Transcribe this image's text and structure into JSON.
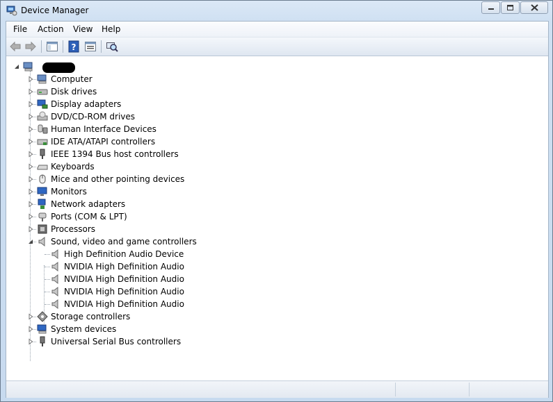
{
  "window": {
    "title": "Device Manager"
  },
  "menu": [
    "File",
    "Action",
    "View",
    "Help"
  ],
  "toolbar": [
    {
      "name": "back-button",
      "icon": "arrow-left-icon"
    },
    {
      "name": "forward-button",
      "icon": "arrow-right-icon"
    },
    {
      "name": "show-hide-console-tree-button",
      "icon": "console-tree-icon"
    },
    {
      "name": "help-button",
      "icon": "help-icon"
    },
    {
      "name": "properties-button",
      "icon": "properties-icon"
    },
    {
      "name": "scan-hardware-button",
      "icon": "scan-hardware-icon"
    }
  ],
  "tree": {
    "root_label": "",
    "categories": [
      {
        "label": "Computer",
        "icon": "computer-icon",
        "expanded": false
      },
      {
        "label": "Disk drives",
        "icon": "disk-drive-icon",
        "expanded": false
      },
      {
        "label": "Display adapters",
        "icon": "display-adapter-icon",
        "expanded": false
      },
      {
        "label": "DVD/CD-ROM drives",
        "icon": "dvd-drive-icon",
        "expanded": false
      },
      {
        "label": "Human Interface Devices",
        "icon": "hid-icon",
        "expanded": false
      },
      {
        "label": "IDE ATA/ATAPI controllers",
        "icon": "ide-controller-icon",
        "expanded": false
      },
      {
        "label": "IEEE 1394 Bus host controllers",
        "icon": "ieee1394-icon",
        "expanded": false
      },
      {
        "label": "Keyboards",
        "icon": "keyboard-icon",
        "expanded": false
      },
      {
        "label": "Mice and other pointing devices",
        "icon": "mouse-icon",
        "expanded": false
      },
      {
        "label": "Monitors",
        "icon": "monitor-icon",
        "expanded": false
      },
      {
        "label": "Network adapters",
        "icon": "network-adapter-icon",
        "expanded": false
      },
      {
        "label": "Ports (COM & LPT)",
        "icon": "port-icon",
        "expanded": false
      },
      {
        "label": "Processors",
        "icon": "processor-icon",
        "expanded": false
      },
      {
        "label": "Sound, video and game controllers",
        "icon": "speaker-icon",
        "expanded": true,
        "children": [
          {
            "label": "High Definition Audio Device",
            "icon": "speaker-icon"
          },
          {
            "label": "NVIDIA High Definition Audio",
            "icon": "speaker-icon"
          },
          {
            "label": "NVIDIA High Definition Audio",
            "icon": "speaker-icon"
          },
          {
            "label": "NVIDIA High Definition Audio",
            "icon": "speaker-icon"
          },
          {
            "label": "NVIDIA High Definition Audio",
            "icon": "speaker-icon"
          }
        ]
      },
      {
        "label": "Storage controllers",
        "icon": "storage-controller-icon",
        "expanded": false
      },
      {
        "label": "System devices",
        "icon": "system-device-icon",
        "expanded": false
      },
      {
        "label": "Universal Serial Bus controllers",
        "icon": "usb-icon",
        "expanded": false
      }
    ]
  }
}
